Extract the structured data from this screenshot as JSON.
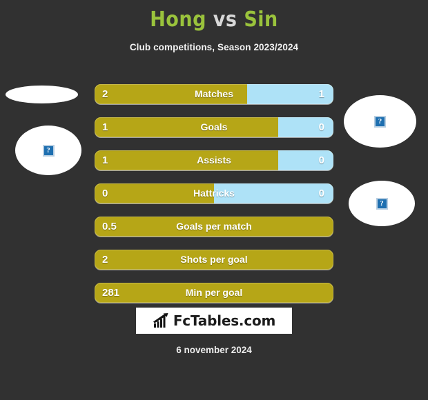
{
  "header": {
    "title_home": "Hong",
    "title_vs": "vs",
    "title_away": "Sin",
    "subtitle": "Club competitions, Season 2023/2024"
  },
  "colors": {
    "background": "#313131",
    "title_green": "#9ac33c",
    "bar_home": "#b6a617",
    "bar_away": "#aee2f7",
    "logo_box": "#ffffff",
    "text": "#ffffff"
  },
  "avatars": [
    {
      "name": "home-flag",
      "alt": "?"
    },
    {
      "name": "home-player",
      "alt": "?"
    },
    {
      "name": "away-flag",
      "alt": "?"
    },
    {
      "name": "away-player",
      "alt": "?"
    }
  ],
  "chart_data": {
    "type": "bar",
    "title": "Hong vs Sin",
    "subtitle": "Club competitions, Season 2023/2024",
    "orientation": "horizontal-diverging",
    "categories": [
      "Matches",
      "Goals",
      "Assists",
      "Hattricks",
      "Goals per match",
      "Shots per goal",
      "Min per goal"
    ],
    "series": [
      {
        "name": "Hong",
        "values": [
          "2",
          "1",
          "1",
          "0",
          "0.5",
          "2",
          "281"
        ]
      },
      {
        "name": "Sin",
        "values": [
          "1",
          "0",
          "0",
          "0",
          null,
          null,
          null
        ]
      }
    ],
    "left_fill_percent": [
      64,
      77,
      77,
      50,
      100,
      100,
      100
    ],
    "legend": [
      "Hong",
      "Sin"
    ],
    "xlabel": "",
    "ylabel": "",
    "grid": false
  },
  "rows": [
    {
      "label": "Matches",
      "left": "2",
      "right": "1",
      "left_pct": 64,
      "split": true
    },
    {
      "label": "Goals",
      "left": "1",
      "right": "0",
      "left_pct": 77,
      "split": true
    },
    {
      "label": "Assists",
      "left": "1",
      "right": "0",
      "left_pct": 77,
      "split": true
    },
    {
      "label": "Hattricks",
      "left": "0",
      "right": "0",
      "left_pct": 50,
      "split": true
    },
    {
      "label": "Goals per match",
      "left": "0.5",
      "right": "",
      "left_pct": 100,
      "split": false
    },
    {
      "label": "Shots per goal",
      "left": "2",
      "right": "",
      "left_pct": 100,
      "split": false
    },
    {
      "label": "Min per goal",
      "left": "281",
      "right": "",
      "left_pct": 100,
      "split": false
    }
  ],
  "footer": {
    "logo_text": "FcTables.com",
    "logo_icon": "bar-chart-icon",
    "date": "6 november 2024"
  }
}
